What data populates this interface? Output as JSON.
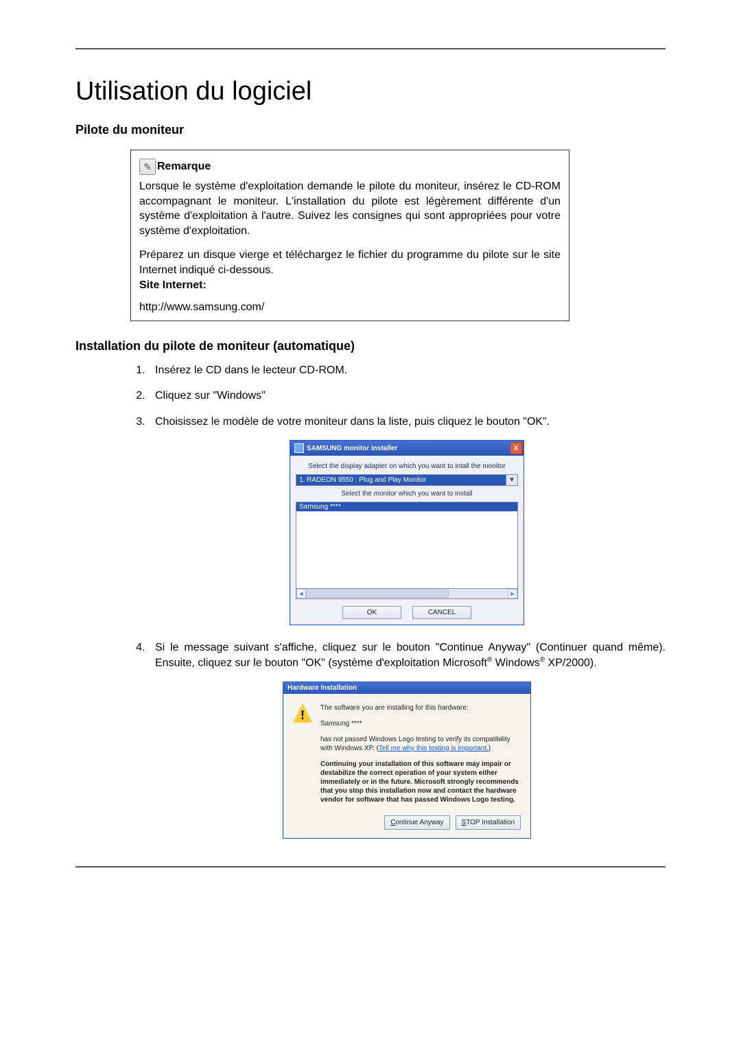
{
  "title": "Utilisation du logiciel",
  "subsection": "Pilote du moniteur",
  "remark": {
    "label": "Remarque",
    "p1": "Lorsque le système d'exploitation demande le pilote du moniteur, insérez le CD-ROM accompagnant le moniteur. L'installation du pilote est légèrement différente d'un système d'exploitation à l'autre. Suivez les consignes qui sont appropriées pour votre système d'exploitation.",
    "p2": "Préparez un disque vierge et téléchargez le fichier du programme du pilote sur le site Internet indiqué ci-dessous.",
    "site_label": "Site Internet:",
    "site_url": "http://www.samsung.com/"
  },
  "install_section": "Installation du pilote de moniteur (automatique)",
  "steps": {
    "s1": "Insérez le CD dans le lecteur CD-ROM.",
    "s2": "Cliquez sur \"Windows\"",
    "s3": "Choisissez le modèle de votre moniteur dans la liste, puis cliquez le bouton \"OK\".",
    "s4_a": "Si le message suivant s'affiche, cliquez sur le bouton \"Continue Anyway\" (Continuer quand même). Ensuite, cliquez sur le bouton \"OK\" (système d'exploitation Microsoft",
    "s4_b": " Windows",
    "s4_c": " XP/2000)."
  },
  "samsung_dialog": {
    "title": "SAMSUNG monitor installer",
    "close": "X",
    "line1": "Select the display adapter on which you want to intall the monitor",
    "adapter": "1. RADEON 9550 : Plug and Play Monitor",
    "line2": "Select the monitor which you want to install",
    "list_selected": "Samsung ****",
    "ok": "OK",
    "cancel": "CANCEL"
  },
  "hw_dialog": {
    "title": "Hardware Installation",
    "p1": "The software you are installing for this hardware:",
    "p2": "Samsung ****",
    "p3a": "has not passed Windows Logo testing to verify its compatibility with Windows XP. (",
    "p3_link": "Tell me why this testing is important.",
    "p3b": ")",
    "warn": "Continuing your installation of this software may impair or destabilize the correct operation of your system either immediately or in the future. Microsoft strongly recommends that you stop this installation now and contact the hardware vendor for software that has passed Windows Logo testing.",
    "btn_continue_u": "C",
    "btn_continue_rest": "ontinue Anyway",
    "btn_stop_u": "S",
    "btn_stop_rest": "TOP Installation"
  }
}
